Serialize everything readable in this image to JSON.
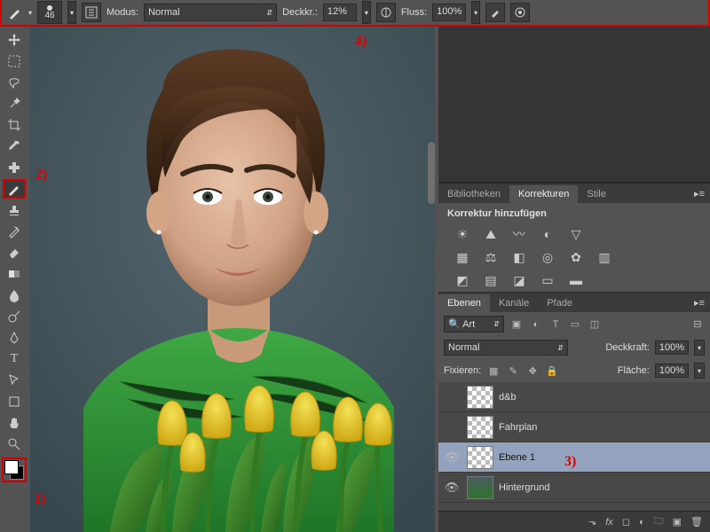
{
  "annotations": {
    "a1": "1)",
    "a2": "2)",
    "a3": "3)",
    "a4": "4)"
  },
  "options_bar": {
    "brush_size": "46",
    "modus_label": "Modus:",
    "modus_value": "Normal",
    "deckkr_label": "Deckkr.:",
    "deckkr_value": "12%",
    "fluss_label": "Fluss:",
    "fluss_value": "100%"
  },
  "panels": {
    "tabs_top": {
      "bibliotheken": "Bibliotheken",
      "korrekturen": "Korrekturen",
      "stile": "Stile"
    },
    "korr_title": "Korrektur hinzufügen"
  },
  "layers_panel": {
    "tabs": {
      "ebenen": "Ebenen",
      "kanaele": "Kanäle",
      "pfade": "Pfade"
    },
    "filter_label": "Art",
    "blend": "Normal",
    "deckkraft_label": "Deckkraft:",
    "deckkraft_value": "100%",
    "fixieren_label": "Fixieren:",
    "flaeche_label": "Fläche:",
    "flaeche_value": "100%",
    "layers": [
      {
        "name": "d&b",
        "visible": false,
        "thumb": "chk"
      },
      {
        "name": "Fahrplan",
        "visible": false,
        "thumb": "chk"
      },
      {
        "name": "Ebene 1",
        "visible": true,
        "thumb": "chk",
        "selected": true
      },
      {
        "name": "Hintergrund",
        "visible": true,
        "thumb": "img"
      }
    ],
    "footer_icons": [
      "fx",
      "mask",
      "adj",
      "group",
      "new",
      "trash"
    ]
  },
  "search_icon": "🔍"
}
